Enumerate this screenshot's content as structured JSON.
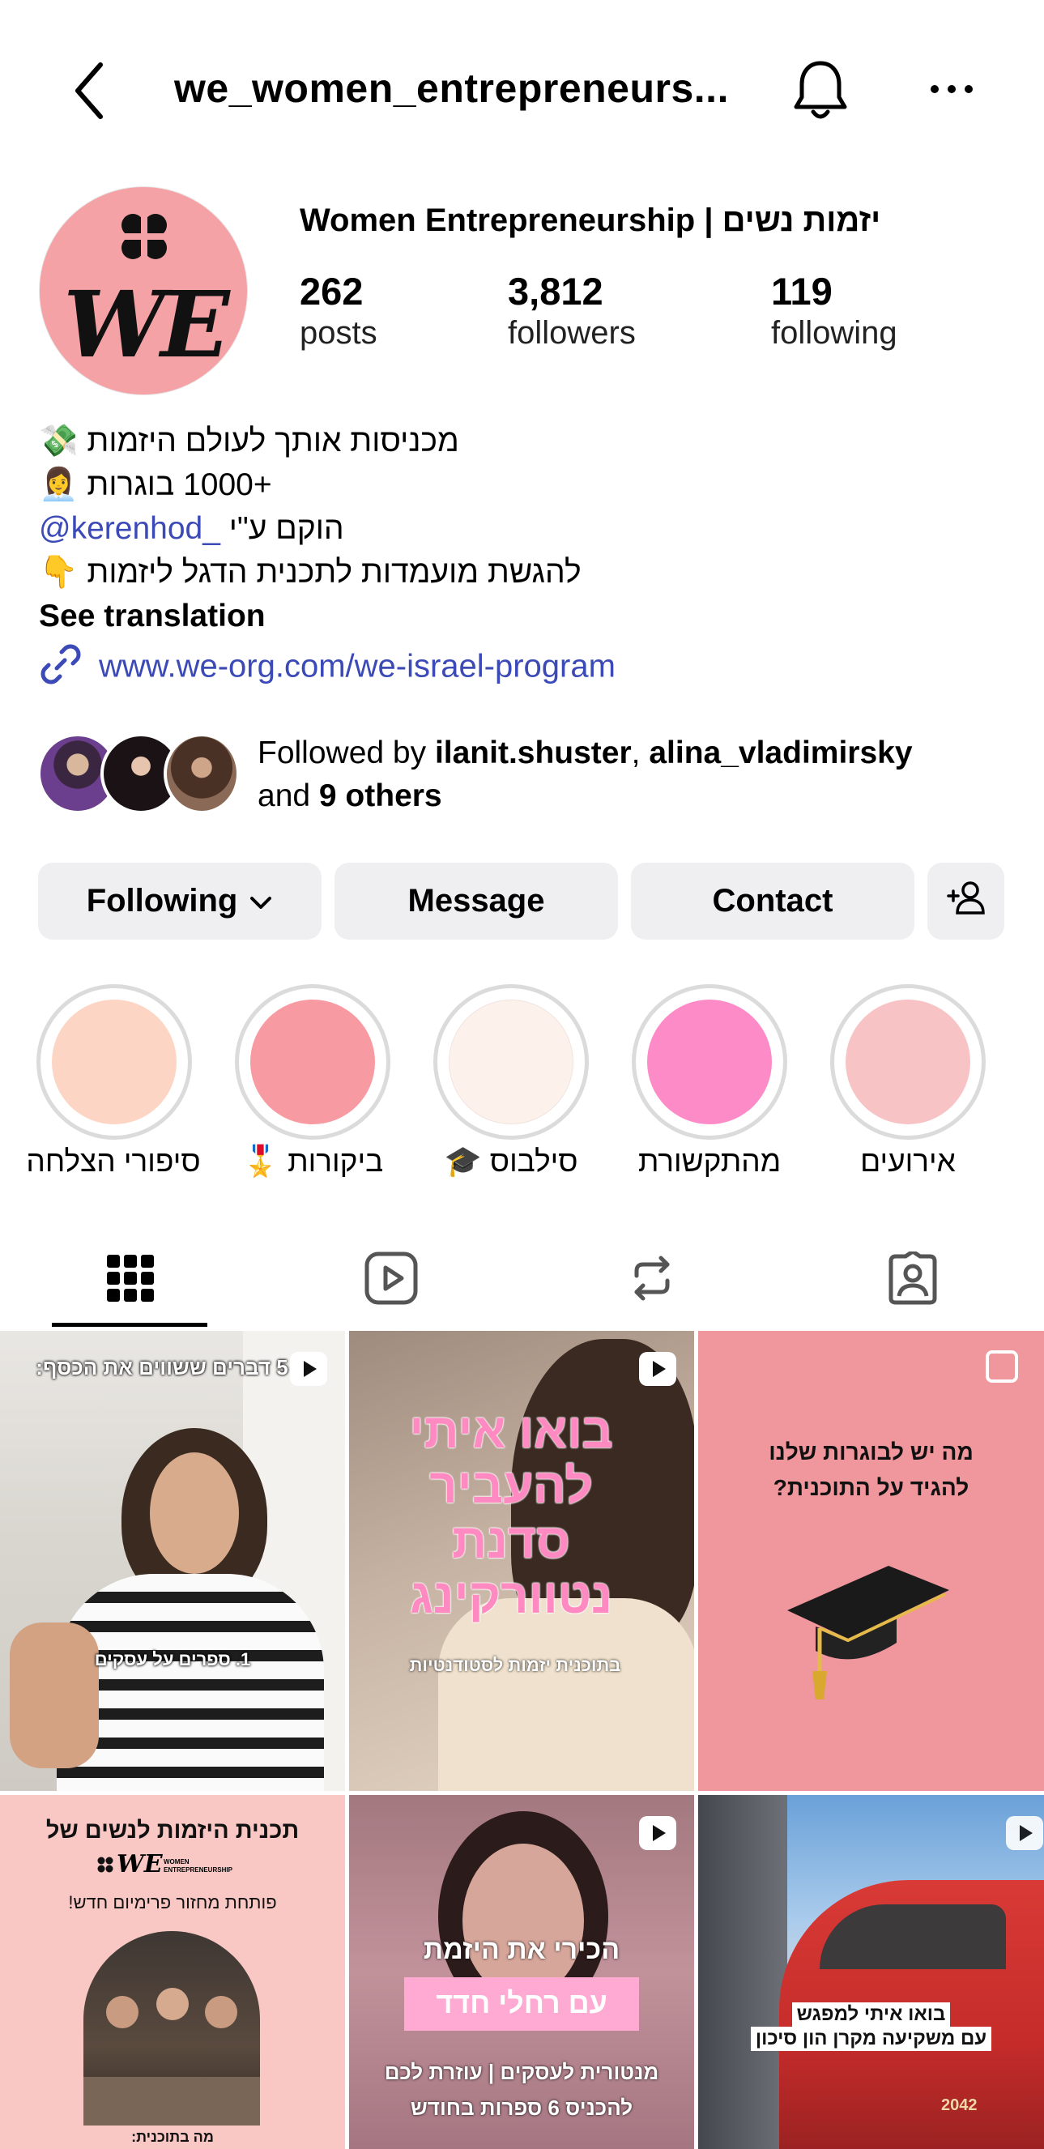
{
  "header": {
    "username": "we_women_entrepreneurs...",
    "back_icon": "chevron-left-icon",
    "bell_icon": "bell-icon",
    "more_icon": "more-horizontal-icon"
  },
  "profile": {
    "display_name": "Women Entrepreneurship | יזמות נשים",
    "avatar_text": "WE",
    "stats": [
      {
        "value": "262",
        "label": "posts"
      },
      {
        "value": "3,812",
        "label": "followers"
      },
      {
        "value": "119",
        "label": "following"
      }
    ],
    "bio": {
      "line1": "מכניסות אותך לעולם היזמות",
      "line1_emoji": "💸",
      "line2": "+1000 בוגרות",
      "line2_emoji": "👩‍💼",
      "line3_text": "הוקם ע\"י",
      "line3_mention": "@kerenhod_",
      "line4": "להגשת מועמדות לתכנית הדגל ליזמות",
      "line4_emoji": "👇",
      "see_translation": "See translation"
    },
    "link": "www.we-org.com/we-israel-program"
  },
  "followed_by": {
    "prefix": "Followed by ",
    "user1": "ilanit.shuster",
    "sep": ", ",
    "user2": "alina_vladimirsky",
    "and": "and ",
    "others": "9 others"
  },
  "buttons": {
    "following": "Following",
    "message": "Message",
    "contact": "Contact"
  },
  "highlights": [
    {
      "label": "סיפורי הצלחה",
      "color": "#fdd5c4"
    },
    {
      "label": "ביקורות 🎖️",
      "color": "#f89aa2"
    },
    {
      "label": "סילבוס 🎓",
      "color": "#fdf1ec"
    },
    {
      "label": "מהתקשורת",
      "color": "#fd8bc8"
    },
    {
      "label": "אירועים",
      "color": "#f8c3c4"
    }
  ],
  "tabs": [
    "grid-icon",
    "reels-icon",
    "reposts-icon",
    "tagged-icon"
  ],
  "posts": [
    {
      "headline": "5 דברים ששווים את הכסף:",
      "caption": "1. ספרים על עסקים"
    },
    {
      "headline_1": "בואו איתי",
      "headline_2": "להעביר",
      "headline_3": "סדנת",
      "headline_4": "נטוורקינג",
      "caption": "בתוכנית יזמות לסטודנטיות"
    },
    {
      "headline_1": "מה יש לבוגרות שלנו",
      "headline_2": "להגיד על התוכנית?"
    },
    {
      "headline": "תכנית היזמות לנשים של",
      "logo": "WE",
      "logo_sub_1": "WOMEN",
      "logo_sub_2": "ENTREPRENEURSHIP",
      "caption": "פותחת מחזור פרימיום חדש!",
      "footer": "מה בתוכנית:"
    },
    {
      "headline_1": "הכירי את היזמת",
      "headline_2": "עם רחלי חדד",
      "caption_1": "מנטורית לעסקים | עוזרת לכם",
      "caption_2": "להכניס 6 ספרות בחודש"
    },
    {
      "caption_1": "בואו איתי למפגש",
      "caption_2": "עם משקיעה מקרן הון סיכון",
      "train_number": "2042"
    }
  ]
}
